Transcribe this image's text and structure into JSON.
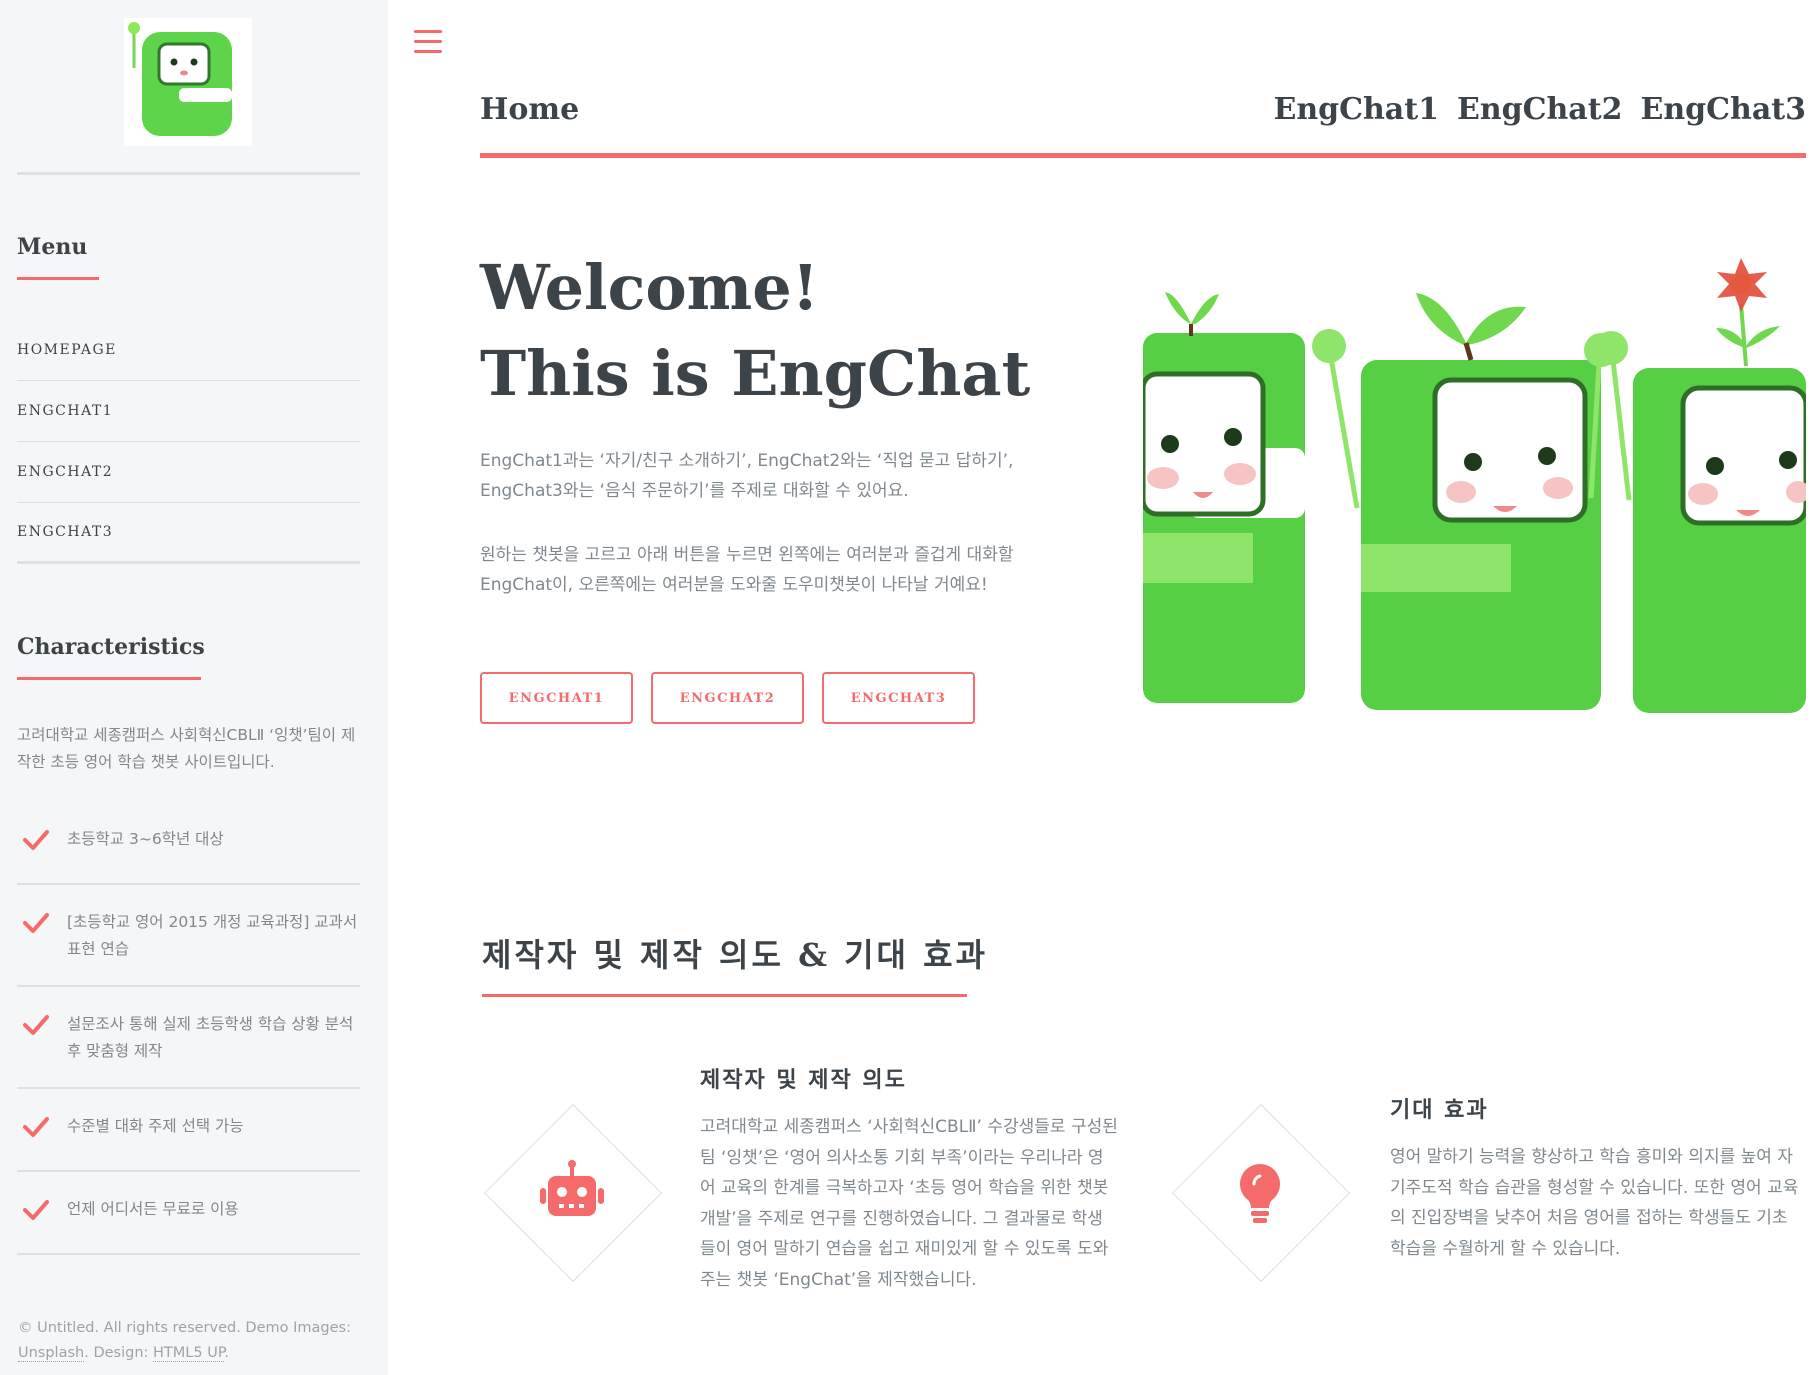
{
  "sidebar": {
    "menu_heading": "Menu",
    "menu_items": [
      {
        "label": "HOMEPAGE"
      },
      {
        "label": "ENGCHAT1"
      },
      {
        "label": "ENGCHAT2"
      },
      {
        "label": "ENGCHAT3"
      }
    ],
    "characteristics_heading": "Characteristics",
    "characteristics_intro": "고려대학교 세종캠퍼스 사회혁신CBLⅡ ‘잉챗’팀이 제작한 초등 영어 학습 챗봇 사이트입니다.",
    "characteristics": [
      {
        "text": "초등학교 3~6학년 대상"
      },
      {
        "text": "[초등학교 영어 2015 개정 교육과정] 교과서 표현 연습"
      },
      {
        "text": "설문조사 통해 실제 초등학생 학습 상황 분석 후 맞춤형 제작"
      },
      {
        "text": "수준별 대화 주제 선택 가능"
      },
      {
        "text": "언제 어디서든 무료로 이용"
      }
    ],
    "footer": {
      "prefix": "© Untitled. All rights reserved. Demo Images: ",
      "unsplash": "Unsplash",
      "middle": ". Design: ",
      "html5up": "HTML5 UP",
      "suffix": "."
    }
  },
  "topbar": {
    "home_label": "Home",
    "links": [
      {
        "label": "EngChat1"
      },
      {
        "label": "EngChat2"
      },
      {
        "label": "EngChat3"
      }
    ]
  },
  "banner": {
    "title_line1": "Welcome!",
    "title_line2": "This is EngChat",
    "paragraph1": "EngChat1과는 ‘자기/친구 소개하기’, EngChat2와는 ‘직업 묻고 답하기’, EngChat3와는 ‘음식 주문하기’를 주제로 대화할 수 있어요.",
    "paragraph2": "원하는 챗봇을 고르고 아래 버튼을 누르면 왼쪽에는 여러분과 즐겁게 대화할 EngChat이, 오른쪽에는 여러분을 도와줄 도우미챗봇이 나타날 거예요!",
    "buttons": [
      {
        "label": "ENGCHAT1"
      },
      {
        "label": "ENGCHAT2"
      },
      {
        "label": "ENGCHAT3"
      }
    ]
  },
  "section": {
    "title": "제작자 및 제작 의도 & 기대 효과",
    "features": [
      {
        "icon": "robot-icon",
        "title": "제작자 및 제작 의도",
        "text": "고려대학교 세종캠퍼스 ‘사회혁신CBLⅡ’ 수강생들로 구성된 팀 ‘잉챗’은 ‘영어 의사소통 기회 부족’이라는 우리나라 영어 교육의 한계를 극복하고자 ‘초등 영어 학습을 위한 챗봇 개발’을 주제로 연구를 진행하였습니다. 그 결과물로 학생들이 영어 말하기 연습을 쉽고 재미있게 할 수 있도록 도와주는 챗봇 ‘EngChat’을 제작했습니다."
      },
      {
        "icon": "lightbulb-icon",
        "title": "기대 효과",
        "text": "영어 말하기 능력을 향상하고 학습 흥미와 의지를 높여 자기주도적 학습 습관을 형성할 수 있습니다. 또한 영어 교육의 진입장벽을 낮추어 처음 영어를 접하는 학생들도 기초 학습을 수월하게 할 수 있습니다."
      }
    ]
  },
  "colors": {
    "accent": "#f56a6a",
    "heading": "#3d4449",
    "body_text": "#7f888f",
    "sidebar_bg": "#f5f6f7",
    "character_green": "#5ed44a"
  }
}
